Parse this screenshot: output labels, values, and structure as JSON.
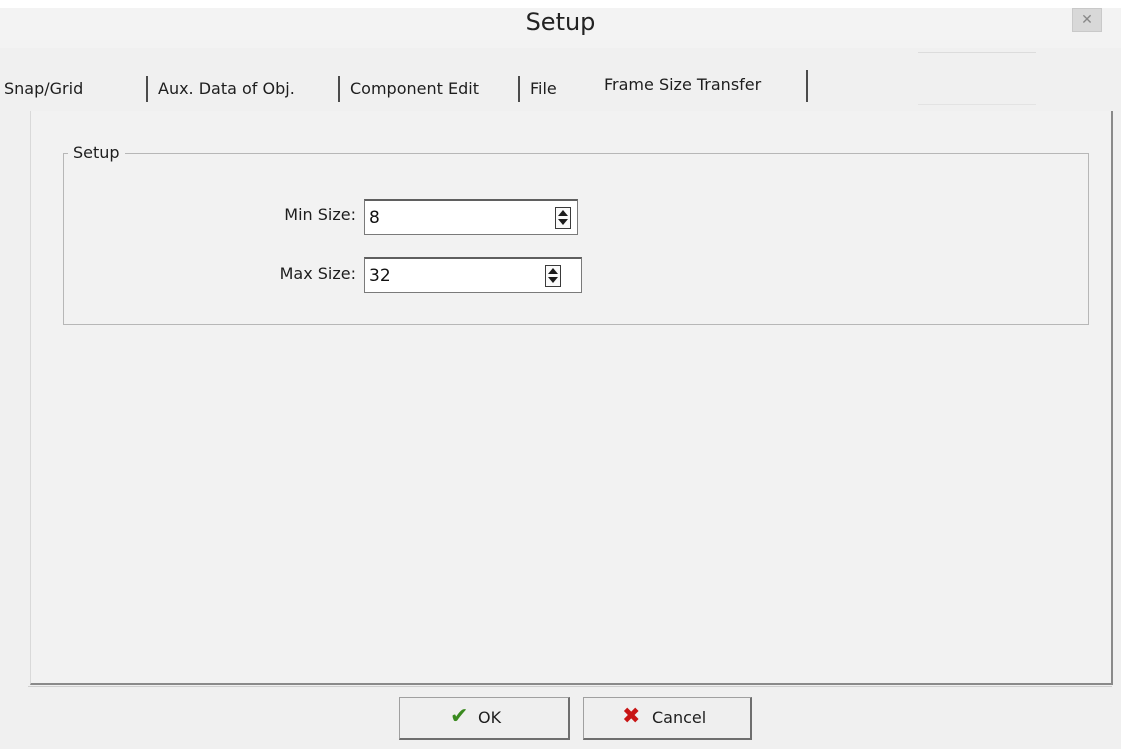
{
  "window": {
    "title": "Setup",
    "close_icon": "close-icon"
  },
  "tabs": [
    {
      "label": "Snap/Grid"
    },
    {
      "label": "Aux. Data of Obj."
    },
    {
      "label": "Component Edit"
    },
    {
      "label": "File"
    },
    {
      "label": "Frame Size Transfer",
      "active": true
    }
  ],
  "group": {
    "legend": "Setup"
  },
  "fields": {
    "min_size": {
      "label": "Min Size:",
      "value": "8"
    },
    "max_size": {
      "label": "Max Size:",
      "value": "32"
    }
  },
  "buttons": {
    "ok": {
      "label": "OK",
      "icon": "checkmark-icon",
      "icon_color": "#3a8a1f"
    },
    "cancel": {
      "label": "Cancel",
      "icon": "x-icon",
      "icon_color": "#c81414"
    }
  }
}
